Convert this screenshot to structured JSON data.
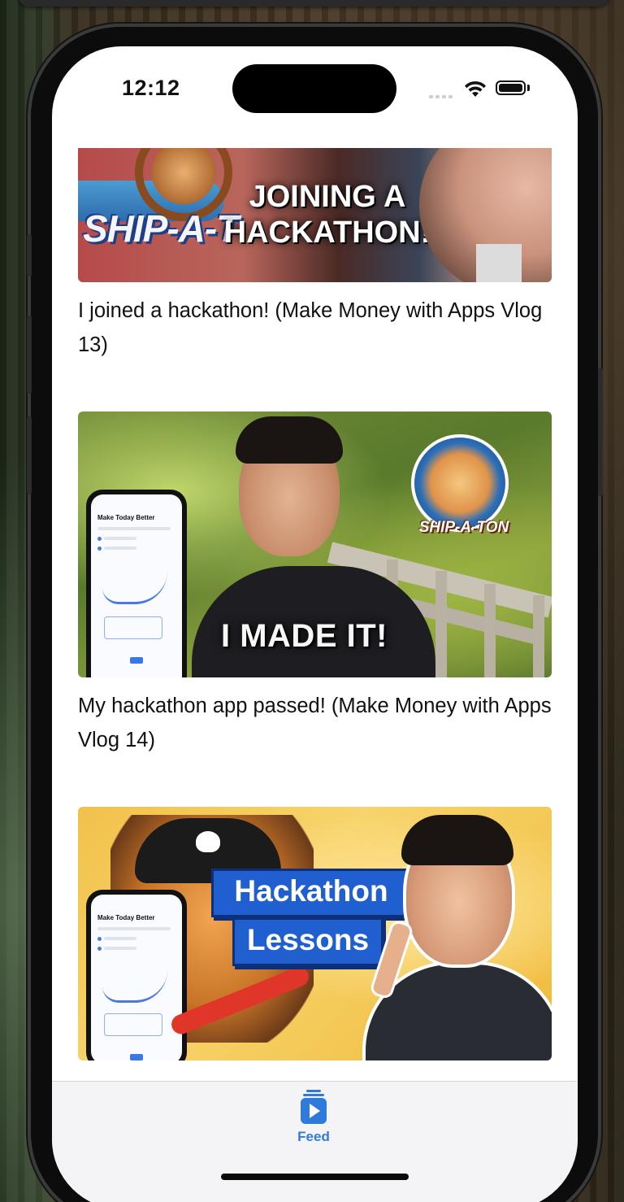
{
  "status_bar": {
    "time": "12:12"
  },
  "feed": {
    "items": [
      {
        "thumbnail_text": [
          "JOINING  A",
          "HACKATHON!"
        ],
        "thumbnail_brand": "SHIP-A-T",
        "title": "I joined a hackathon! (Make Money with Apps Vlog 13)"
      },
      {
        "thumbnail_text": [
          "I MADE IT!"
        ],
        "thumbnail_brand": "SHIP-A-TON",
        "phone_screen_title": "Make Today Better",
        "title": "My hackathon app passed! (Make Money with Apps Vlog 14)"
      },
      {
        "thumbnail_text": [
          "Hackathon",
          "Lessons"
        ],
        "phone_screen_title": "Make Today Better",
        "title": ""
      }
    ]
  },
  "tab_bar": {
    "tabs": [
      {
        "label": "Feed",
        "icon": "play-stack-icon",
        "selected": true
      }
    ]
  },
  "colors": {
    "accent": "#2f7bdc",
    "screen_background": "#ffffff",
    "tab_bar_background": "#f4f4f6"
  }
}
